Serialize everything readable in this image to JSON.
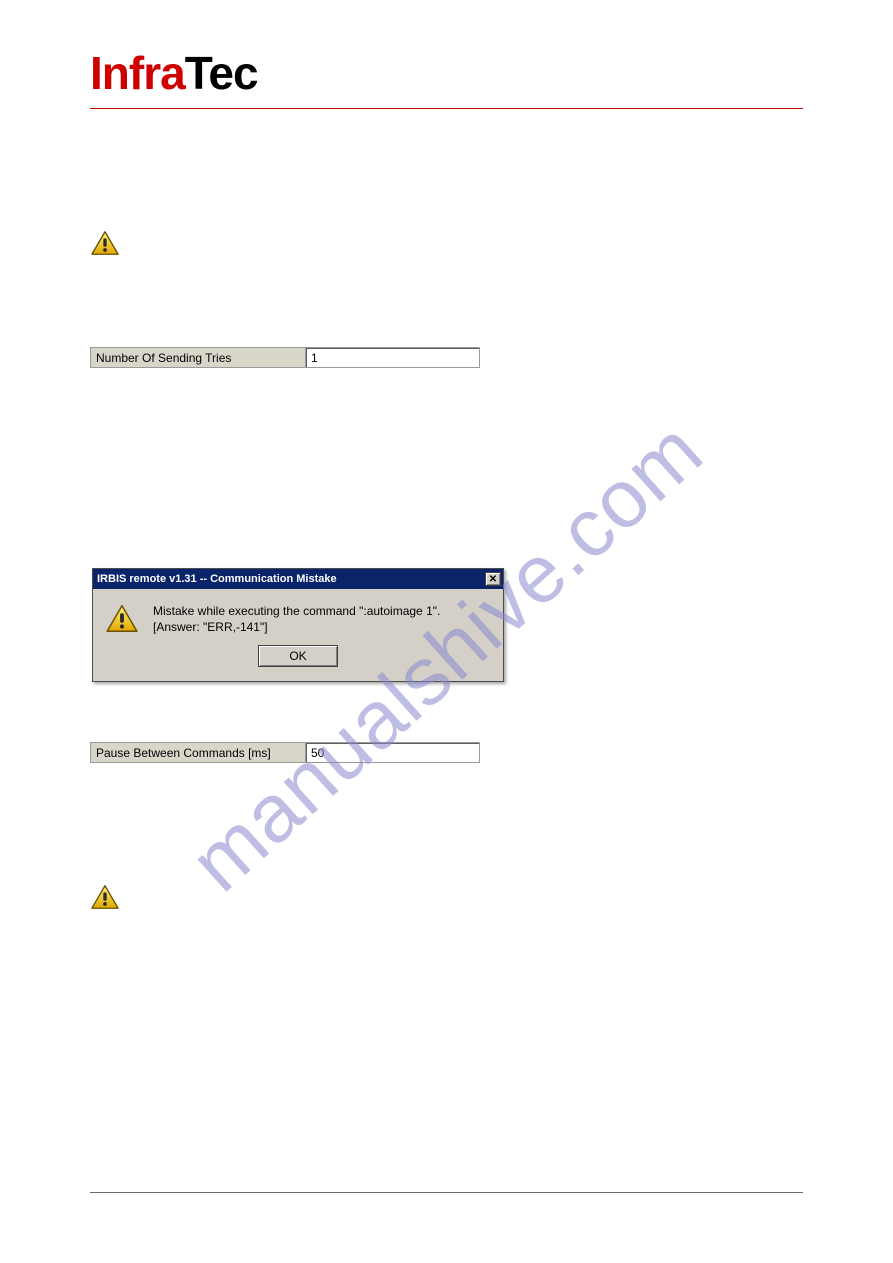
{
  "brand": {
    "part1": "Infra",
    "part2": "Tec"
  },
  "watermark": "manualshive.com",
  "field_sending": {
    "label": "Number Of Sending Tries",
    "value": "1"
  },
  "dialog": {
    "title": "IRBIS remote v1.31 -- Communication Mistake",
    "line1": "Mistake while executing the command \":autoimage 1\".",
    "line2": "[Answer: \"ERR,-141\"]",
    "ok_label": "OK",
    "close_symbol": "✕"
  },
  "field_pause": {
    "label": "Pause Between Commands [ms]",
    "value": "50"
  }
}
